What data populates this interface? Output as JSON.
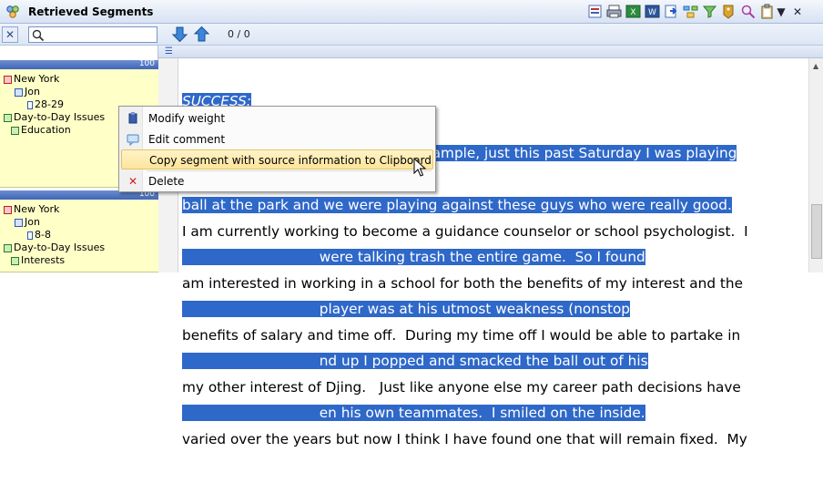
{
  "window": {
    "title": "Retrieved Segments",
    "close_glyph": "✕",
    "menu_glyph": "▼"
  },
  "toolbar": {
    "close_glyph": "✕",
    "search": {
      "value": "",
      "placeholder": ""
    },
    "counter": "0 / 0"
  },
  "left_header": {
    "score_label": "100"
  },
  "segments": [
    {
      "score": "100",
      "nodes": [
        {
          "label": "New York",
          "icon": "doc-group-icon"
        },
        {
          "label": "Jon",
          "icon": "doc-icon"
        },
        {
          "label": "28-29",
          "icon": "paragraph-icon"
        },
        {
          "label": "Day-to-Day Issues",
          "icon": "code-icon"
        },
        {
          "label": "Education",
          "icon": "code-icon"
        }
      ]
    },
    {
      "score": "100",
      "nodes": [
        {
          "label": "New York",
          "icon": "doc-group-icon"
        },
        {
          "label": "Jon",
          "icon": "doc-icon"
        },
        {
          "label": "8-8",
          "icon": "paragraph-icon"
        },
        {
          "label": "Day-to-Day Issues",
          "icon": "code-icon"
        },
        {
          "label": "Interests",
          "icon": "code-icon"
        }
      ]
    }
  ],
  "document": {
    "para1_lines": [
      "SUCCESS:",
      "I find success in little things.  For example, just this past Saturday I was playing",
      "ball at the park and we were playing against these guys who were really good.",
      "                               were talking trash the entire game.  So I found",
      "                               player was at his utmost weakness (nonstop",
      "                               nd up I popped and smacked the ball out of his",
      "                               en his own teammates.  I smiled on the inside."
    ],
    "para2_lines": [
      "I am currently working to become a guidance counselor or school psychologist.  I",
      "am interested in working in a school for both the benefits of my interest and the",
      "benefits of salary and time off.  During my time off I would be able to partake in",
      "my other interest of Djing.   Just like anyone else my career path decisions have",
      "varied over the years but now I think I have found one that will remain fixed.  My"
    ]
  },
  "context_menu": {
    "items": [
      {
        "label": "Modify weight",
        "icon": "weight-icon"
      },
      {
        "label": "Edit comment",
        "icon": "comment-icon"
      },
      {
        "label": "Copy segment with source information to Clipboard",
        "icon": "",
        "highlighted": true
      },
      {
        "label": "Delete",
        "icon": "delete-icon"
      }
    ]
  },
  "colors": {
    "selection": "#2e68c9",
    "segment_bg": "#ffffc8",
    "segment_bar": "#3f66b8",
    "highlight": "#fde59a"
  }
}
